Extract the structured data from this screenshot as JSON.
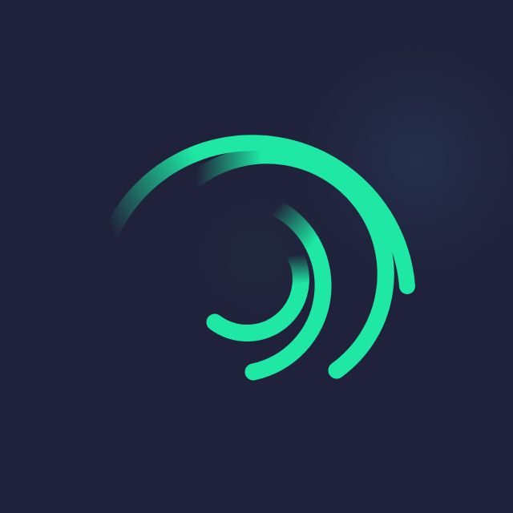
{
  "logo": {
    "name": "swirl-arcs-logo",
    "accent_color": "#1ee8a3",
    "background_color": "#20223b",
    "glow_color": "#24304f"
  }
}
